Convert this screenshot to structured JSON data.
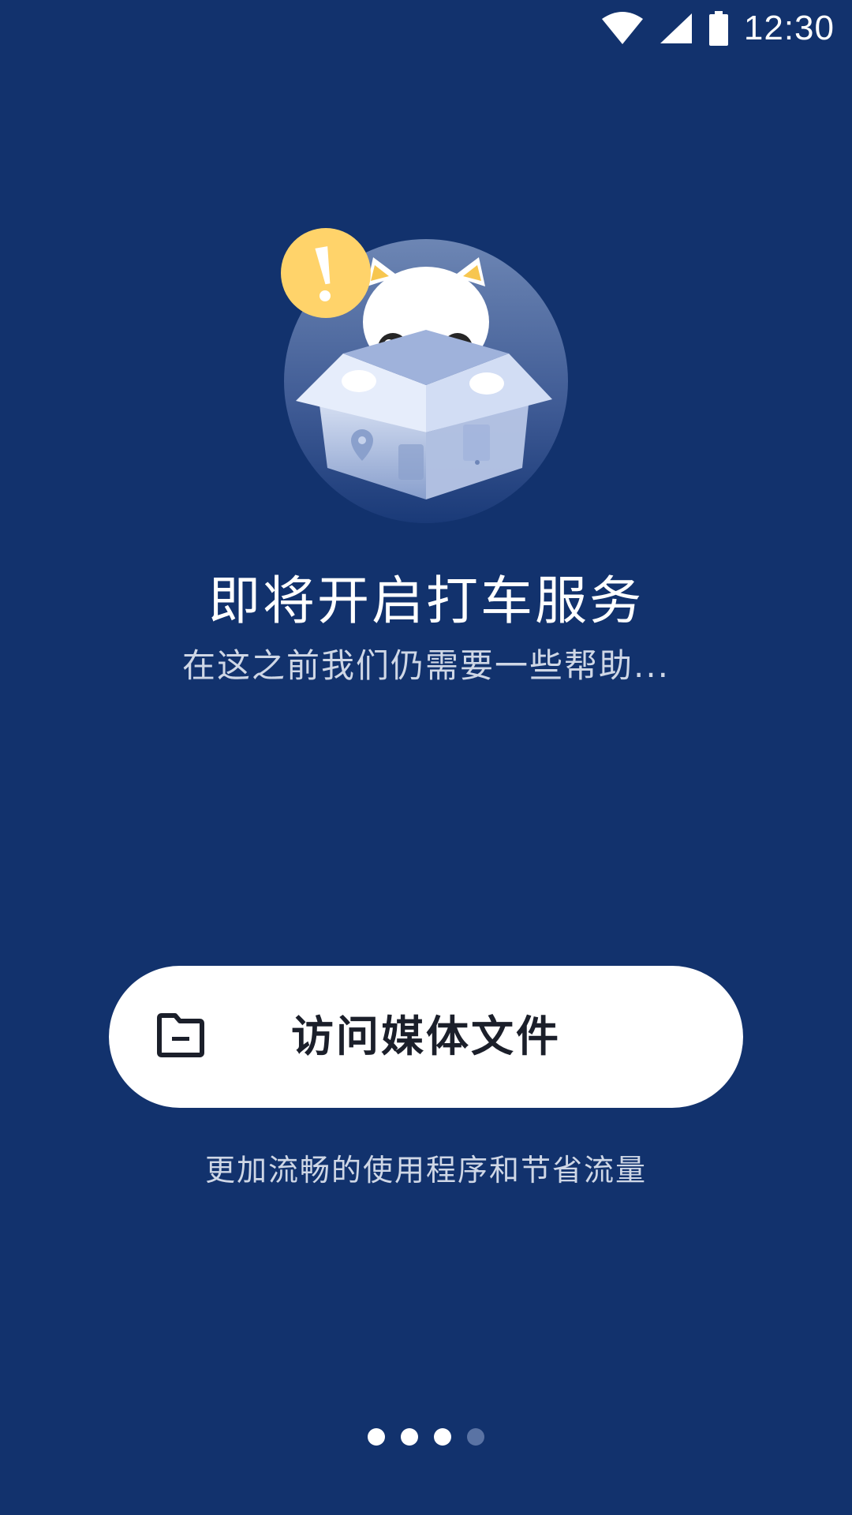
{
  "status_bar": {
    "time": "12:30",
    "icons": [
      "wifi-icon",
      "cellular-signal-icon",
      "battery-icon"
    ]
  },
  "illustration": {
    "name": "cat-in-box-illustration",
    "alert_badge": "!"
  },
  "title": "即将开启打车服务",
  "subtitle": "在这之前我们仍需要一些帮助...",
  "permission_button": {
    "icon": "folder-icon",
    "label": "访问媒体文件"
  },
  "hint": "更加流畅的使用程序和节省流量",
  "pager": {
    "total": 4,
    "current": 4
  },
  "colors": {
    "background": "#12326d",
    "button_background": "#ffffff",
    "button_text": "#1b1f2a",
    "alert_yellow": "#ffd36a",
    "dot_active": "#ffffff",
    "dot_inactive": "#5a73a4"
  }
}
